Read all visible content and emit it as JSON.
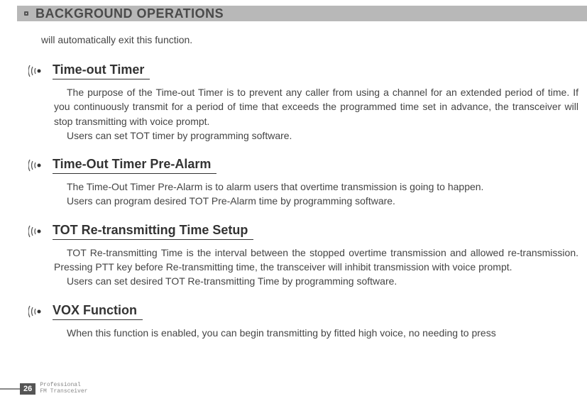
{
  "header": {
    "title": "BACKGROUND OPERATIONS"
  },
  "intro": "will automatically exit this function.",
  "sections": [
    {
      "heading": "Time-out Timer",
      "paragraphs": [
        "The purpose of the Time-out Timer is to prevent any caller from using a channel for an extended period of time. If you continuously transmit for a period of time that exceeds the programmed time set in advance, the transceiver will stop transmitting with voice prompt.",
        "Users can set TOT timer by programming software."
      ]
    },
    {
      "heading": "Time-Out Timer Pre-Alarm",
      "paragraphs": [
        "The Time-Out Timer Pre-Alarm is to alarm users that overtime transmission is going to happen.",
        "Users can program desired TOT Pre-Alarm time by programming software."
      ]
    },
    {
      "heading": "TOT Re-transmitting Time Setup",
      "paragraphs": [
        "TOT Re-transmitting Time is the interval between the stopped overtime transmission and allowed re-transmission. Pressing PTT key before Re-transmitting time, the transceiver will inhibit transmission with voice prompt.",
        "Users can set desired TOT Re-transmitting Time by programming software."
      ]
    },
    {
      "heading": "VOX Function",
      "paragraphs": [
        "When this function is enabled, you can begin transmitting by fitted high voice, no needing to press"
      ]
    }
  ],
  "footer": {
    "page": "26",
    "line1": "Professional",
    "line2": "FM Transceiver"
  }
}
